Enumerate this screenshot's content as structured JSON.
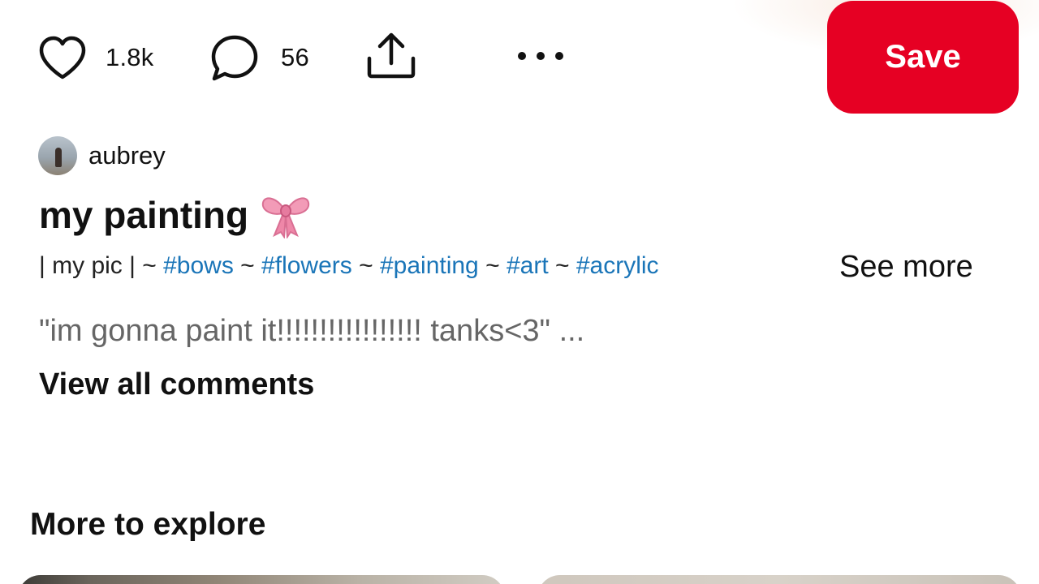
{
  "actions": {
    "like_count": "1.8k",
    "comment_count": "56",
    "save_label": "Save"
  },
  "pin": {
    "author": "aubrey",
    "title": "my painting",
    "description_prefix": "| my pic | ~ ",
    "hashtags": [
      "#bows",
      "#flowers",
      "#painting",
      "#art",
      "#acrylic"
    ],
    "separator": " ~ ",
    "see_more_label": "See more",
    "comment_preview": "\"im gonna paint it!!!!!!!!!!!!!!!!! tanks<3\" ...",
    "view_comments_label": "View all comments"
  },
  "explore": {
    "heading": "More to explore"
  },
  "colors": {
    "save_button": "#e60023",
    "hashtag": "#1a75b8",
    "muted_text": "#666666"
  },
  "icons": [
    "heart-icon",
    "comment-bubble-icon",
    "share-icon",
    "more-options-icon",
    "bow-emoji"
  ]
}
